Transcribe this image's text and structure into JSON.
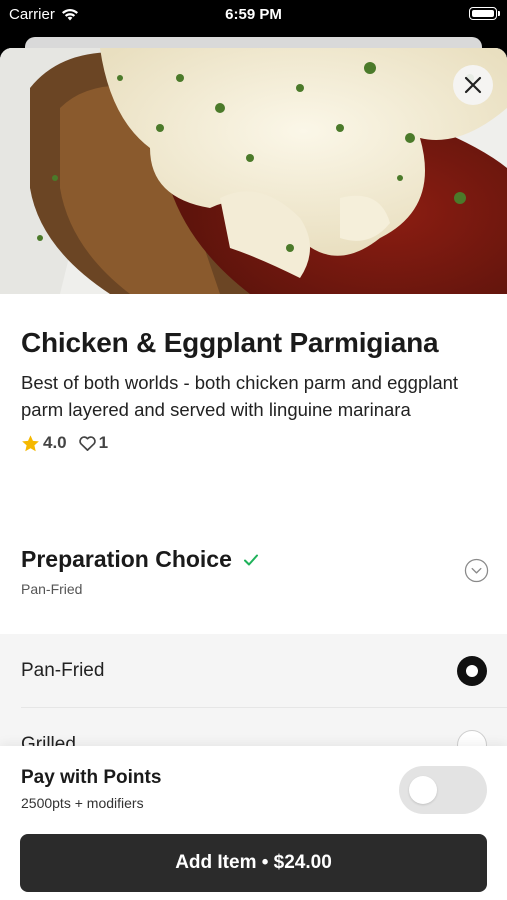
{
  "status_bar": {
    "carrier": "Carrier",
    "time": "6:59 PM"
  },
  "item": {
    "title": "Chicken & Eggplant Parmigiana",
    "description": "Best of both worlds - both chicken parm and eggplant parm layered and served with linguine marinara",
    "rating": "4.0",
    "likes": "1"
  },
  "preparation": {
    "title": "Preparation Choice",
    "selected": "Pan-Fried",
    "options": [
      {
        "label": "Pan-Fried",
        "selected": true
      },
      {
        "label": "Grilled",
        "selected": false
      }
    ]
  },
  "points": {
    "title": "Pay with Points",
    "subtitle": "2500pts + modifiers",
    "enabled": false
  },
  "add_button": {
    "label": "Add Item • $24.00"
  },
  "colors": {
    "accent": "#2b2b2b",
    "star": "#f5b800",
    "check": "#1fb25a"
  },
  "icons": {
    "close": "close-icon",
    "star": "star-icon",
    "heart": "heart-icon",
    "check": "check-icon",
    "chevron": "chevron-down-circle-icon",
    "wifi": "wifi-icon",
    "battery": "battery-icon"
  }
}
